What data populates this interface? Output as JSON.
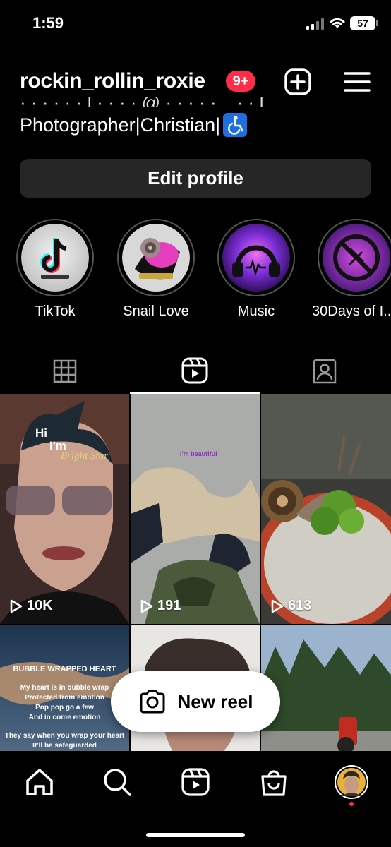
{
  "status": {
    "time": "1:59",
    "battery": "57"
  },
  "header": {
    "username": "rockin_rollin_roxie",
    "notifications": "9+"
  },
  "bio": {
    "line_cut": "·  ·  ·  ·  ·  ·  | ·  ·  ·  ·  @  ·  ·  ·  ·  ·  _  ·  ·  |",
    "line": "Photographer|Christian|"
  },
  "actions": {
    "edit_profile": "Edit profile"
  },
  "highlights": [
    {
      "label": "TikTok"
    },
    {
      "label": "Snail Love"
    },
    {
      "label": "Music"
    },
    {
      "label": "30Days of I..."
    }
  ],
  "reels": [
    {
      "views": "10K"
    },
    {
      "views": "191"
    },
    {
      "views": "613"
    }
  ],
  "reel_overlay_text": {
    "hi": "Hi",
    "im": "I'm",
    "bright_star": "Bright Star",
    "beautiful": "I'm beautiful",
    "bubble_title": "BUBBLE WRAPPED HEART",
    "bubble_body": "My heart is in bubble wrap\nProtected from emotion\nPop pop go a few\nAnd in come emotion",
    "bubble_tail": "They say when you wrap your heart\nIt'll be safeguarded"
  },
  "fab": {
    "label": "New reel"
  },
  "colors": {
    "badge": "#ff2d47",
    "edit_button": "#262626",
    "accent_dot": "#ff3040"
  }
}
